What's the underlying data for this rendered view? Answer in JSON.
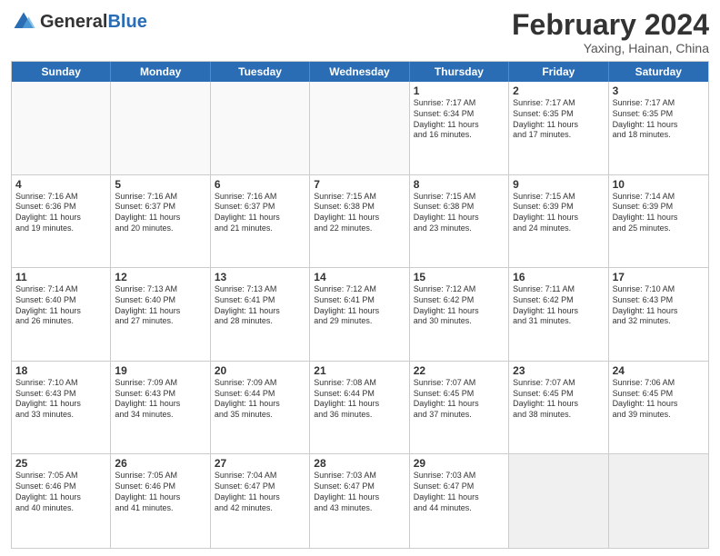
{
  "header": {
    "logo_general": "General",
    "logo_blue": "Blue",
    "month_year": "February 2024",
    "location": "Yaxing, Hainan, China"
  },
  "weekdays": [
    "Sunday",
    "Monday",
    "Tuesday",
    "Wednesday",
    "Thursday",
    "Friday",
    "Saturday"
  ],
  "rows": [
    [
      {
        "day": "",
        "info": "",
        "empty": true
      },
      {
        "day": "",
        "info": "",
        "empty": true
      },
      {
        "day": "",
        "info": "",
        "empty": true
      },
      {
        "day": "",
        "info": "",
        "empty": true
      },
      {
        "day": "1",
        "info": "Sunrise: 7:17 AM\nSunset: 6:34 PM\nDaylight: 11 hours\nand 16 minutes."
      },
      {
        "day": "2",
        "info": "Sunrise: 7:17 AM\nSunset: 6:35 PM\nDaylight: 11 hours\nand 17 minutes."
      },
      {
        "day": "3",
        "info": "Sunrise: 7:17 AM\nSunset: 6:35 PM\nDaylight: 11 hours\nand 18 minutes."
      }
    ],
    [
      {
        "day": "4",
        "info": "Sunrise: 7:16 AM\nSunset: 6:36 PM\nDaylight: 11 hours\nand 19 minutes."
      },
      {
        "day": "5",
        "info": "Sunrise: 7:16 AM\nSunset: 6:37 PM\nDaylight: 11 hours\nand 20 minutes."
      },
      {
        "day": "6",
        "info": "Sunrise: 7:16 AM\nSunset: 6:37 PM\nDaylight: 11 hours\nand 21 minutes."
      },
      {
        "day": "7",
        "info": "Sunrise: 7:15 AM\nSunset: 6:38 PM\nDaylight: 11 hours\nand 22 minutes."
      },
      {
        "day": "8",
        "info": "Sunrise: 7:15 AM\nSunset: 6:38 PM\nDaylight: 11 hours\nand 23 minutes."
      },
      {
        "day": "9",
        "info": "Sunrise: 7:15 AM\nSunset: 6:39 PM\nDaylight: 11 hours\nand 24 minutes."
      },
      {
        "day": "10",
        "info": "Sunrise: 7:14 AM\nSunset: 6:39 PM\nDaylight: 11 hours\nand 25 minutes."
      }
    ],
    [
      {
        "day": "11",
        "info": "Sunrise: 7:14 AM\nSunset: 6:40 PM\nDaylight: 11 hours\nand 26 minutes."
      },
      {
        "day": "12",
        "info": "Sunrise: 7:13 AM\nSunset: 6:40 PM\nDaylight: 11 hours\nand 27 minutes."
      },
      {
        "day": "13",
        "info": "Sunrise: 7:13 AM\nSunset: 6:41 PM\nDaylight: 11 hours\nand 28 minutes."
      },
      {
        "day": "14",
        "info": "Sunrise: 7:12 AM\nSunset: 6:41 PM\nDaylight: 11 hours\nand 29 minutes."
      },
      {
        "day": "15",
        "info": "Sunrise: 7:12 AM\nSunset: 6:42 PM\nDaylight: 11 hours\nand 30 minutes."
      },
      {
        "day": "16",
        "info": "Sunrise: 7:11 AM\nSunset: 6:42 PM\nDaylight: 11 hours\nand 31 minutes."
      },
      {
        "day": "17",
        "info": "Sunrise: 7:10 AM\nSunset: 6:43 PM\nDaylight: 11 hours\nand 32 minutes."
      }
    ],
    [
      {
        "day": "18",
        "info": "Sunrise: 7:10 AM\nSunset: 6:43 PM\nDaylight: 11 hours\nand 33 minutes."
      },
      {
        "day": "19",
        "info": "Sunrise: 7:09 AM\nSunset: 6:43 PM\nDaylight: 11 hours\nand 34 minutes."
      },
      {
        "day": "20",
        "info": "Sunrise: 7:09 AM\nSunset: 6:44 PM\nDaylight: 11 hours\nand 35 minutes."
      },
      {
        "day": "21",
        "info": "Sunrise: 7:08 AM\nSunset: 6:44 PM\nDaylight: 11 hours\nand 36 minutes."
      },
      {
        "day": "22",
        "info": "Sunrise: 7:07 AM\nSunset: 6:45 PM\nDaylight: 11 hours\nand 37 minutes."
      },
      {
        "day": "23",
        "info": "Sunrise: 7:07 AM\nSunset: 6:45 PM\nDaylight: 11 hours\nand 38 minutes."
      },
      {
        "day": "24",
        "info": "Sunrise: 7:06 AM\nSunset: 6:45 PM\nDaylight: 11 hours\nand 39 minutes."
      }
    ],
    [
      {
        "day": "25",
        "info": "Sunrise: 7:05 AM\nSunset: 6:46 PM\nDaylight: 11 hours\nand 40 minutes."
      },
      {
        "day": "26",
        "info": "Sunrise: 7:05 AM\nSunset: 6:46 PM\nDaylight: 11 hours\nand 41 minutes."
      },
      {
        "day": "27",
        "info": "Sunrise: 7:04 AM\nSunset: 6:47 PM\nDaylight: 11 hours\nand 42 minutes."
      },
      {
        "day": "28",
        "info": "Sunrise: 7:03 AM\nSunset: 6:47 PM\nDaylight: 11 hours\nand 43 minutes."
      },
      {
        "day": "29",
        "info": "Sunrise: 7:03 AM\nSunset: 6:47 PM\nDaylight: 11 hours\nand 44 minutes."
      },
      {
        "day": "",
        "info": "",
        "empty": true,
        "shaded": true
      },
      {
        "day": "",
        "info": "",
        "empty": true,
        "shaded": true
      }
    ]
  ]
}
